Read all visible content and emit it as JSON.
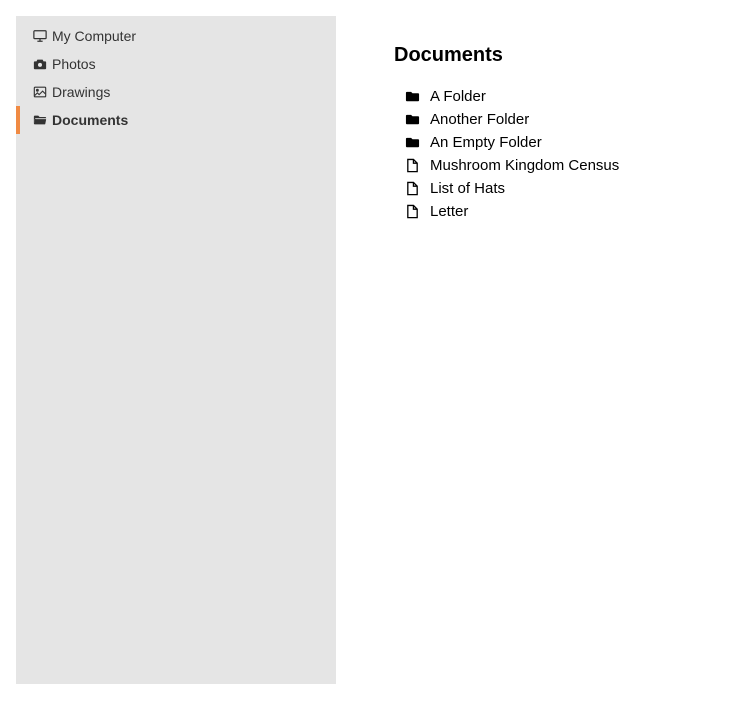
{
  "sidebar": {
    "items": [
      {
        "label": "My Computer",
        "icon": "desktop-icon",
        "active": false
      },
      {
        "label": "Photos",
        "icon": "camera-icon",
        "active": false
      },
      {
        "label": "Drawings",
        "icon": "image-icon",
        "active": false
      },
      {
        "label": "Documents",
        "icon": "folder-open-icon",
        "active": true
      }
    ]
  },
  "main": {
    "title": "Documents",
    "items": [
      {
        "label": "A Folder",
        "icon": "folder-icon",
        "type": "folder"
      },
      {
        "label": "Another Folder",
        "icon": "folder-icon",
        "type": "folder"
      },
      {
        "label": "An Empty Folder",
        "icon": "folder-icon",
        "type": "folder"
      },
      {
        "label": "Mushroom Kingdom Census",
        "icon": "file-icon",
        "type": "file"
      },
      {
        "label": "List of Hats",
        "icon": "file-icon",
        "type": "file"
      },
      {
        "label": "Letter",
        "icon": "file-icon",
        "type": "file"
      }
    ]
  }
}
